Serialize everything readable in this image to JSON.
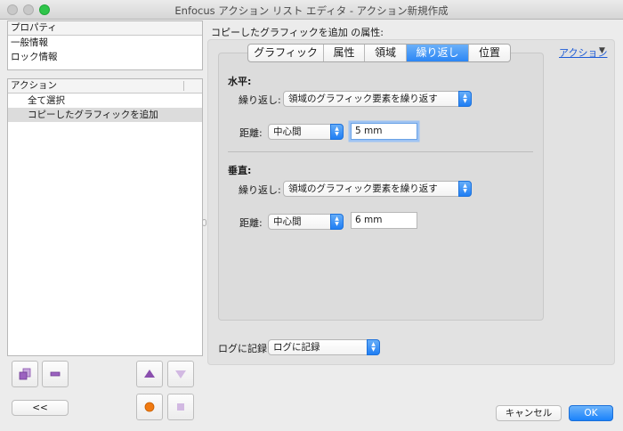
{
  "window": {
    "title": "Enfocus アクション リスト エディタ - アクション新規作成"
  },
  "properties_panel": {
    "header": "プロパティ",
    "items": [
      "一般情報",
      "ロック情報"
    ]
  },
  "actions_panel": {
    "header": "アクション",
    "items": [
      {
        "label": "全て選択",
        "selected": false
      },
      {
        "label": "コピーしたグラフィックを追加",
        "selected": true
      }
    ]
  },
  "left_buttons": {
    "collapse_label": "<<"
  },
  "main": {
    "attributes_label": "コピーしたグラフィックを追加 の属性:",
    "action_link": "アクション",
    "action_arrow": "▼",
    "tabs": [
      {
        "label": "グラフィック",
        "active": false
      },
      {
        "label": "属性",
        "active": false
      },
      {
        "label": "領域",
        "active": false
      },
      {
        "label": "繰り返し",
        "active": true
      },
      {
        "label": "位置",
        "active": false
      }
    ],
    "horizontal": {
      "title": "水平:",
      "repeat_label": "繰り返し:",
      "repeat_value": "領域のグラフィック要素を繰り返す",
      "distance_label": "距離:",
      "distance_mode": "中心間",
      "distance_value": "5 mm"
    },
    "vertical": {
      "title": "垂直:",
      "repeat_label": "繰り返し:",
      "repeat_value": "領域のグラフィック要素を繰り返す",
      "distance_label": "距離:",
      "distance_mode": "中心間",
      "distance_value": "6 mm"
    },
    "log_label": "ログに記録",
    "log_value": "ログに記録"
  },
  "footer": {
    "cancel": "キャンセル",
    "ok": "OK"
  },
  "colors": {
    "accent": "#2b86f5",
    "link": "#1d5bd6",
    "record": "#f07a12",
    "purple": "#8a4fae"
  }
}
